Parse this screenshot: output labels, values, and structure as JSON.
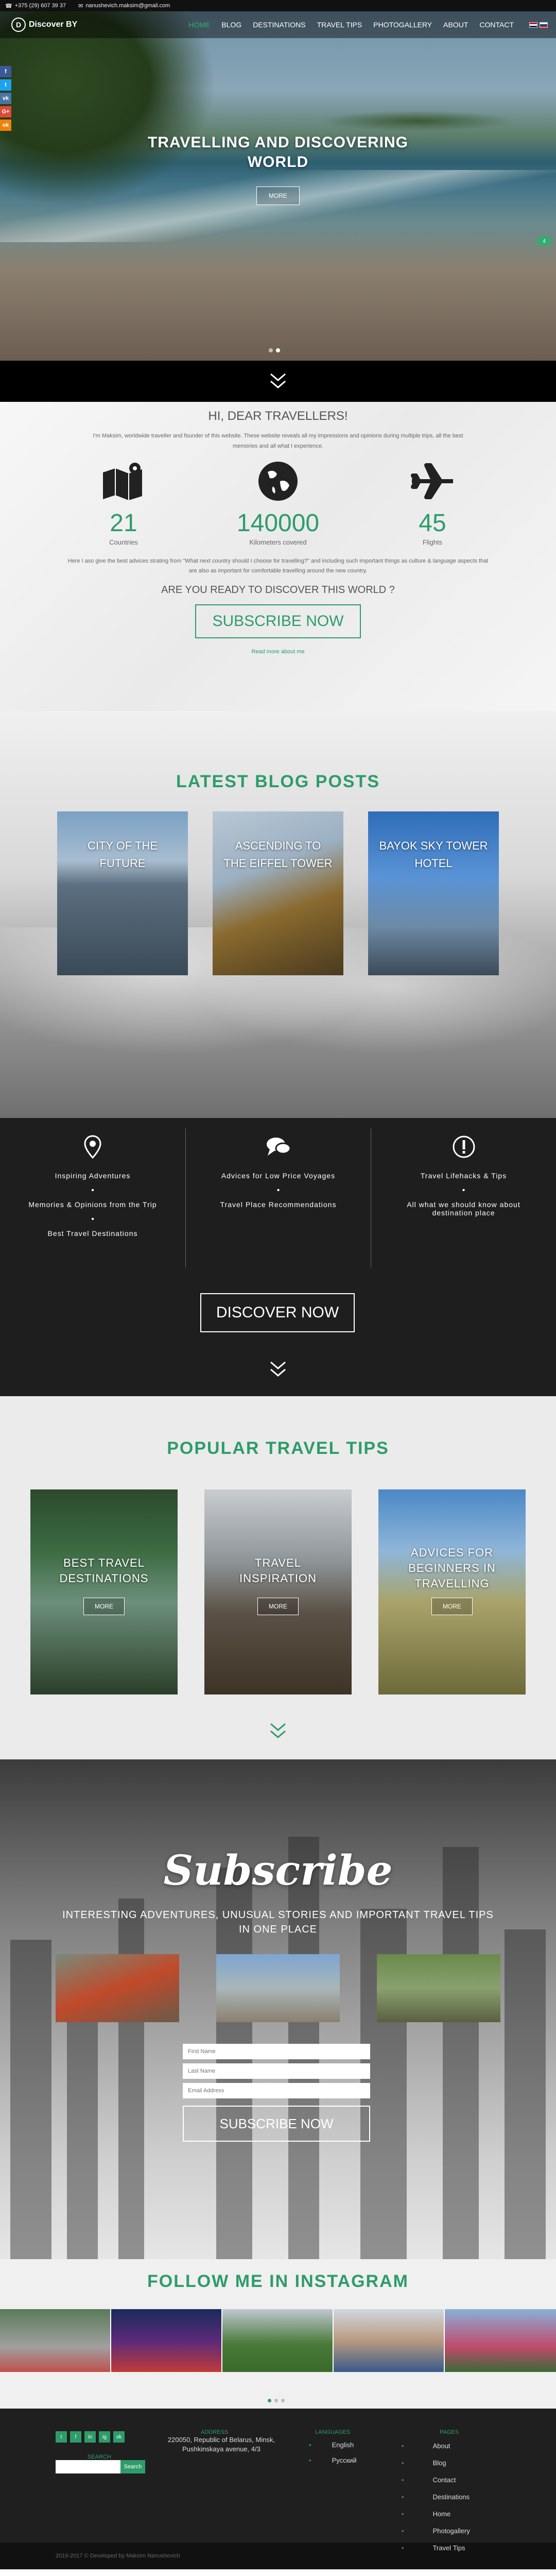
{
  "topbar": {
    "phone": "+375 (29) 607 39 37",
    "email": "nanushevich.maksim@gmail.com"
  },
  "nav": {
    "logo_text": "Discover BY",
    "items": [
      {
        "label": "HOME",
        "active": true
      },
      {
        "label": "BLOG"
      },
      {
        "label": "DESTINATIONS"
      },
      {
        "label": "TRAVEL TIPS"
      },
      {
        "label": "PHOTOGALLERY"
      },
      {
        "label": "ABOUT"
      },
      {
        "label": "CONTACT"
      }
    ]
  },
  "hero": {
    "title_line1": "TRAVELLING AND DISCOVERING",
    "title_line2": "WORLD",
    "button": "MORE",
    "side_badge": "4"
  },
  "social_side": [
    "f",
    "t",
    "vk",
    "G+",
    "ok"
  ],
  "intro": {
    "heading": "HI, DEAR TRAVELLERS!",
    "lead": "I'm Maksim, worldwide traveller and founder of this website. These website reveals all my impressions and opinions during multiple trips, all the best memories and all what I experience.",
    "stats": [
      {
        "icon": "map-icon",
        "number": "21",
        "label": "Countries"
      },
      {
        "icon": "globe-icon",
        "number": "140000",
        "label": "Kilometers covered"
      },
      {
        "icon": "plane-icon",
        "number": "45",
        "label": "Flights"
      }
    ],
    "note": "Here I aso give the best advices strating from \"What next country should I choose for travelling?\" and including such important things as culture & language aspects that are also as important for comfortable travelling around the new country.",
    "question": "ARE YOU READY TO DISCOVER THIS WORLD ?",
    "cta": "SUBSCRIBE NOW",
    "more": "Read more about me"
  },
  "blog": {
    "title": "LATEST BLOG POSTS",
    "posts": [
      {
        "line1": "CITY OF THE",
        "line2": "FUTURE"
      },
      {
        "line1": "ASCENDING TO",
        "line2": "THE EIFFEL TOWER"
      },
      {
        "line1": "BAYOK SKY TOWER",
        "line2": "HOTEL"
      }
    ]
  },
  "features": {
    "cols": [
      {
        "icon": "pin-icon",
        "lines": [
          "Inspiring Adventures",
          "Memories & Opinions from the Trip",
          "Best Travel Destinations"
        ]
      },
      {
        "icon": "chat-icon",
        "lines": [
          "Advices for Low Price Voyages",
          "Travel Place Recommendations"
        ]
      },
      {
        "icon": "alert-icon",
        "lines": [
          "Travel Lifehacks & Tips",
          "All what we should know about destination place"
        ]
      }
    ],
    "discover": "DISCOVER NOW"
  },
  "tips": {
    "title": "POPULAR TRAVEL TIPS",
    "cards": [
      {
        "line1": "BEST TRAVEL",
        "line2": "DESTINATIONS",
        "button": "MORE"
      },
      {
        "line1": "TRAVEL",
        "line2": "INSPIRATION",
        "button": "MORE"
      },
      {
        "line1": "ADVICES FOR",
        "line2": "BEGINNERS IN",
        "line3": "TRAVELLING",
        "button": "MORE"
      }
    ]
  },
  "subscribe": {
    "title": "Subscribe",
    "text": "INTERESTING ADVENTURES, UNUSUAL STORIES AND IMPORTANT TRAVEL TIPS IN ONE PLACE",
    "placeholders": {
      "first": "First Name",
      "last": "Last Name",
      "email": "Email Address"
    },
    "button": "SUBSCRIBE NOW"
  },
  "instagram": {
    "title": "FOLLOW ME IN INSTAGRAM"
  },
  "footer": {
    "social": [
      "t",
      "f",
      "in",
      "ig",
      "vk"
    ],
    "search_label": "SEARCH",
    "search_button": "Search",
    "address_heading": "ADDRESS",
    "address": "220050, Republic of Belarus, Minsk, Pushkinskaya avenue, 4/3",
    "languages_heading": "LANGUAGES",
    "languages": [
      "English",
      "Русский"
    ],
    "pages_heading": "PAGES",
    "pages": [
      "About",
      "Blog",
      "Contact",
      "Destinations",
      "Home",
      "Photogallery",
      "Travel Tips"
    ],
    "copyright": "2016-2017 © Developed by Maksim Nanushevich"
  },
  "colors": {
    "accent": "#2e9c6a",
    "dark": "#1e1e1e"
  }
}
